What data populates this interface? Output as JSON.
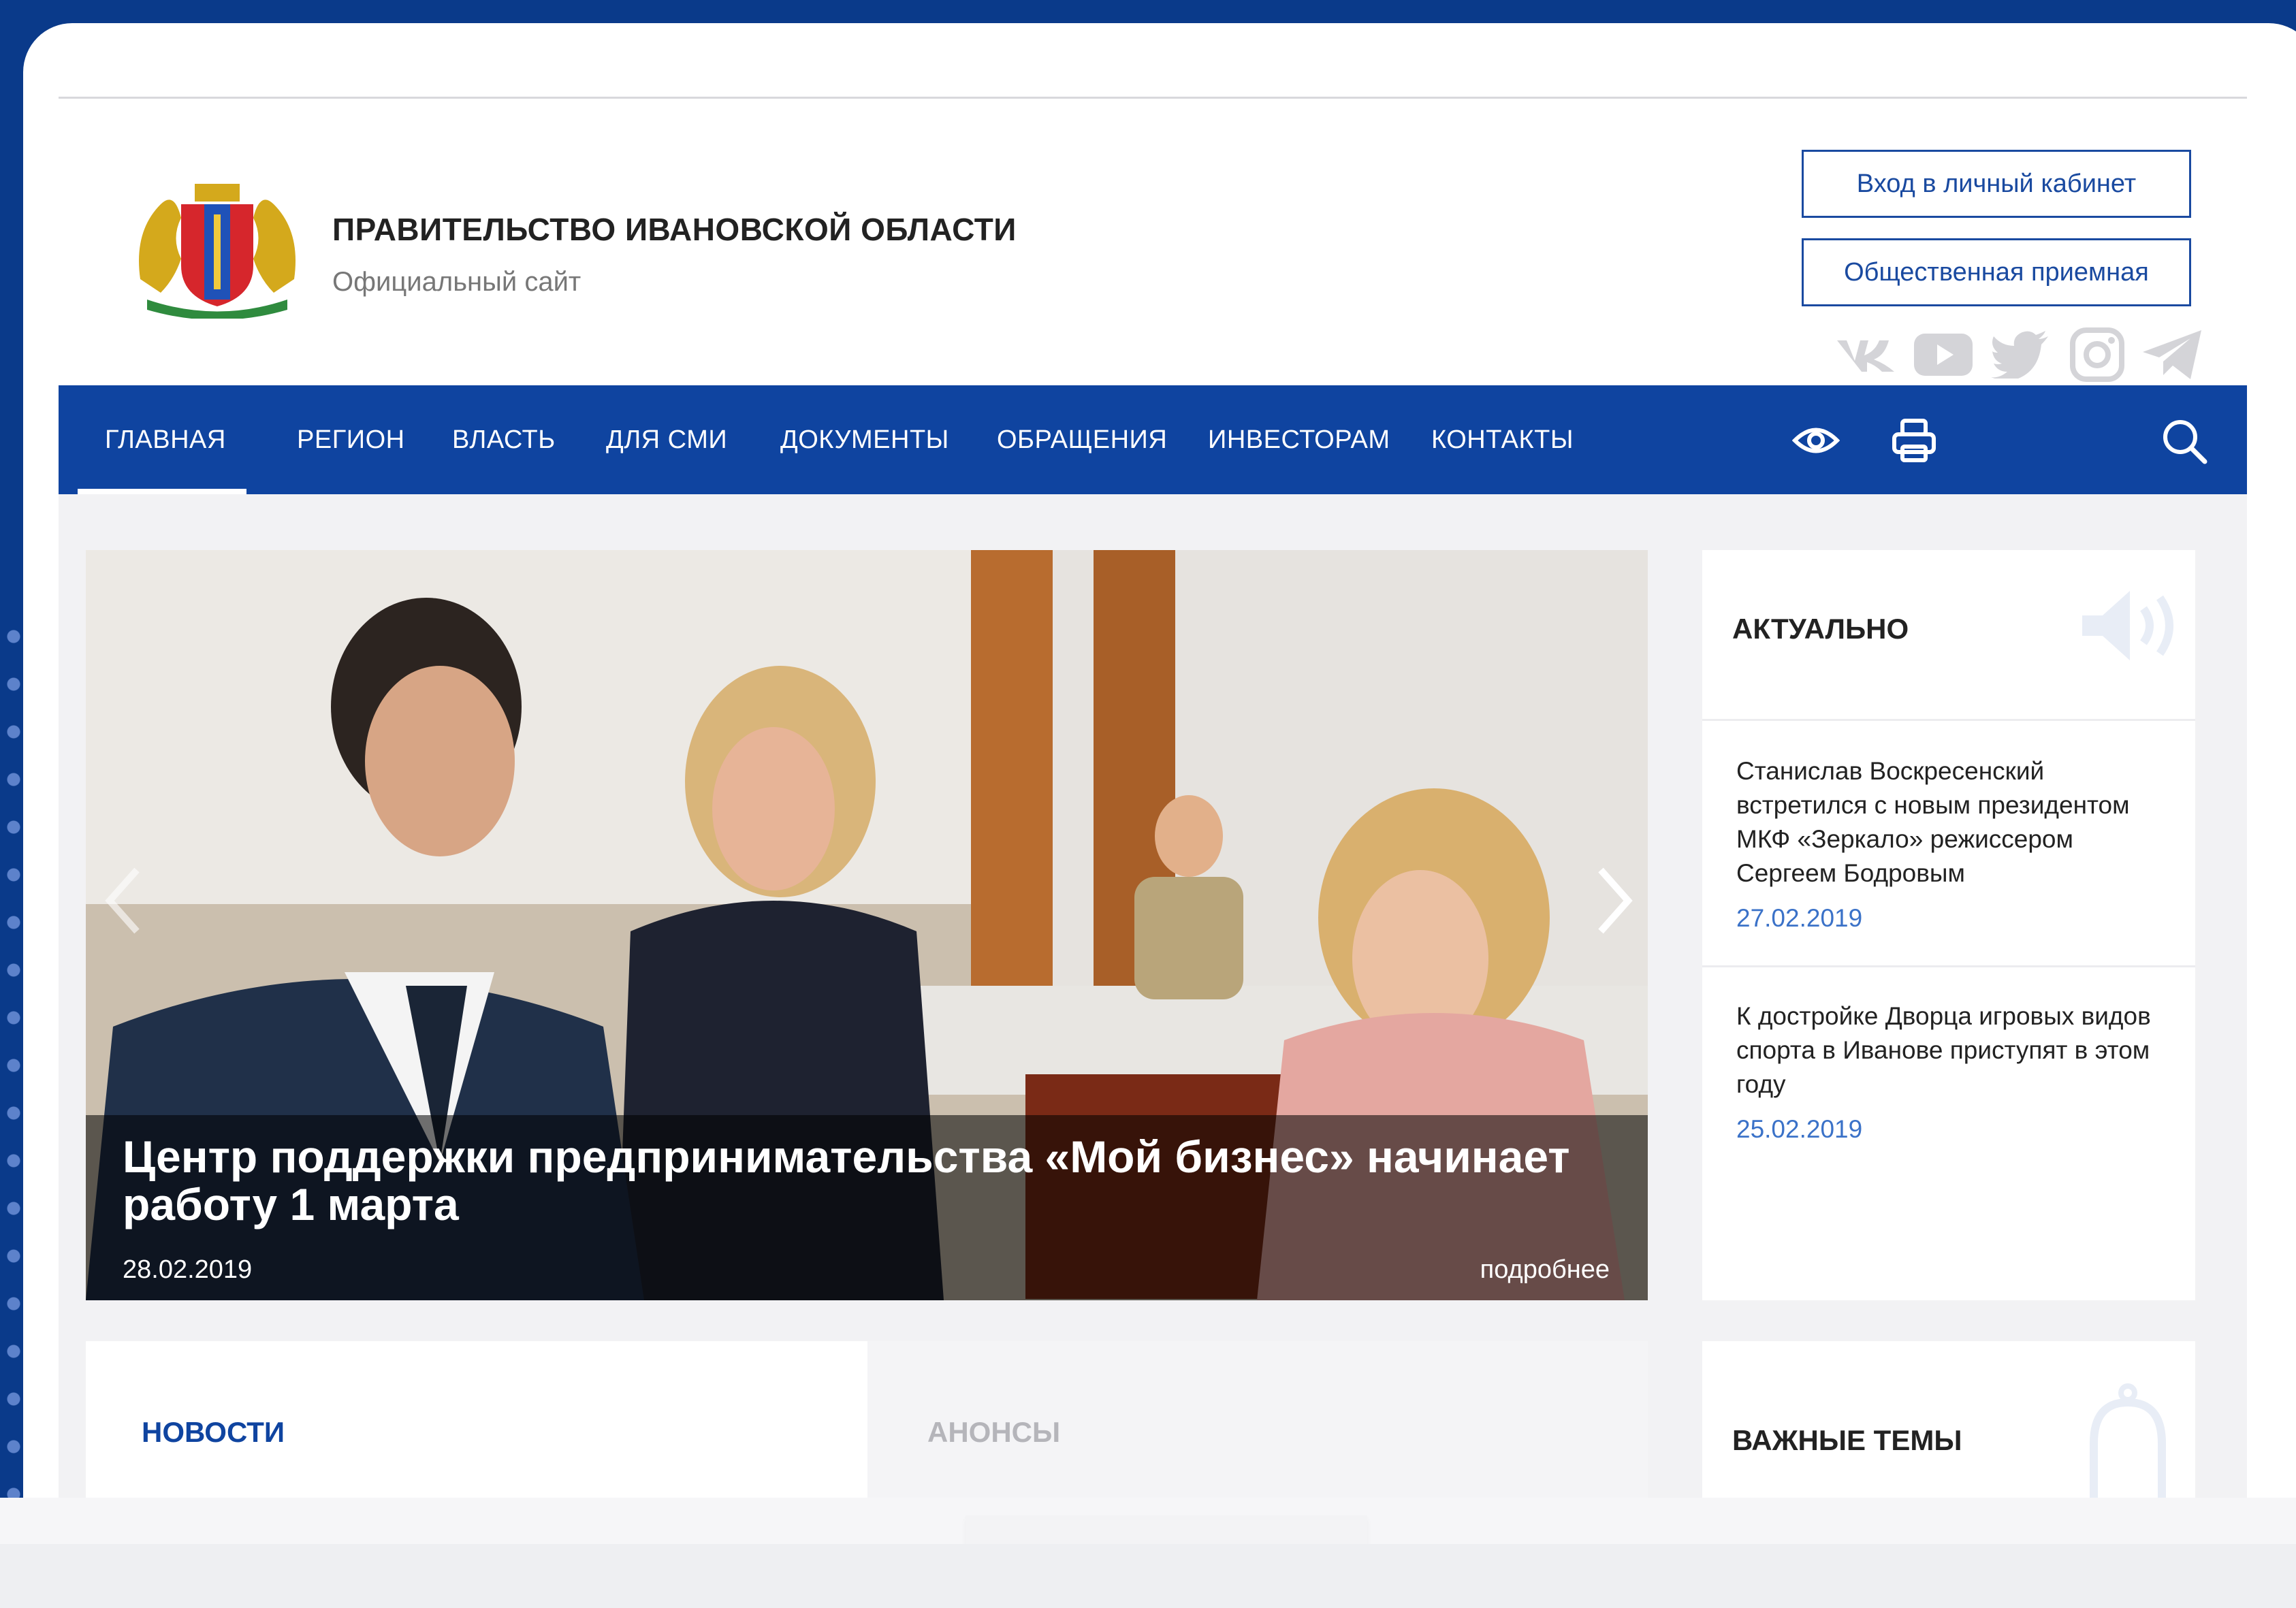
{
  "header": {
    "title": "ПРАВИТЕЛЬСТВО ИВАНОВСКОЙ ОБЛАСТИ",
    "subtitle": "Официальный сайт",
    "cabinet_button": "Вход в личный кабинет",
    "reception_button": "Общественная приемная",
    "social": [
      "vk-icon",
      "youtube-icon",
      "twitter-icon",
      "instagram-icon",
      "telegram-icon"
    ]
  },
  "nav": {
    "items": [
      {
        "label": "ГЛАВНАЯ",
        "active": true
      },
      {
        "label": "РЕГИОН"
      },
      {
        "label": "ВЛАСТЬ"
      },
      {
        "label": "ДЛЯ СМИ"
      },
      {
        "label": "ДОКУМЕНТЫ"
      },
      {
        "label": "ОБРАЩЕНИЯ"
      },
      {
        "label": "ИНВЕСТОРАМ"
      },
      {
        "label": "КОНТАКТЫ"
      }
    ],
    "icons": [
      "eye-icon",
      "printer-icon",
      "search-icon"
    ]
  },
  "hero": {
    "title": "Центр поддержки предпринимательства «Мой бизнес» начинает работу 1 марта",
    "date": "28.02.2019",
    "more": "подробнее"
  },
  "sidebar": {
    "heading": "АКТУАЛЬНО",
    "items": [
      {
        "title": "Станислав Воскресенский встретился с новым президентом МКФ «Зеркало» режиссером Сергеем Бодровым",
        "date": "27.02.2019"
      },
      {
        "title": "К достройке Дворца игровых видов спорта в Иванове приступят в этом году",
        "date": "25.02.2019"
      }
    ]
  },
  "tabs": {
    "news": "НОВОСТИ",
    "announcements": "АНОНСЫ"
  },
  "topics": {
    "heading": "ВАЖНЫЕ ТЕМЫ"
  },
  "colors": {
    "brand_blue": "#0f44a0",
    "outer_blue": "#0a3a8a",
    "date_blue": "#3b72c8"
  }
}
